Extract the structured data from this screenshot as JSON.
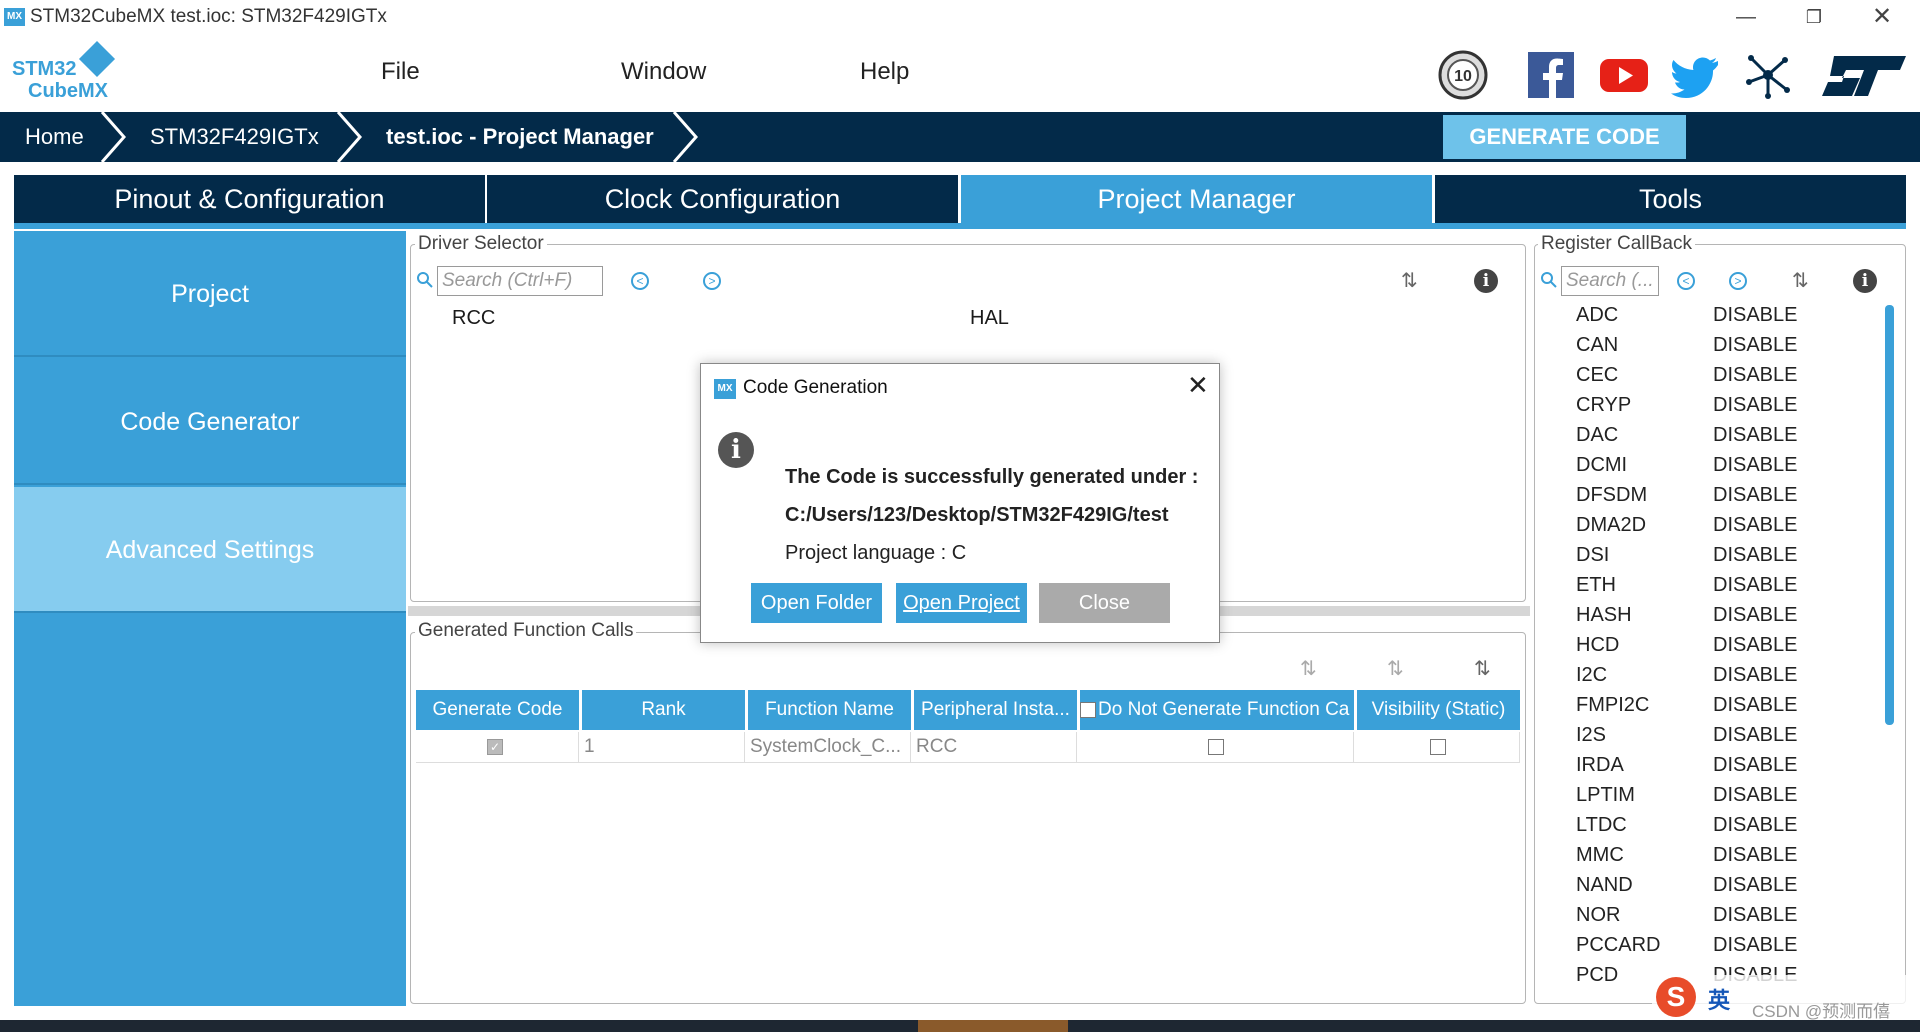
{
  "window": {
    "title": "STM32CubeMX test.ioc: STM32F429IGTx",
    "app_icon": "MX"
  },
  "menu": {
    "logo_line1": "STM32",
    "logo_line2": "CubeMX",
    "items": [
      "File",
      "Window",
      "Help"
    ],
    "social_icons": [
      "anniversary-10-icon",
      "facebook-icon",
      "youtube-icon",
      "twitter-icon",
      "network-icon",
      "st-logo-icon"
    ],
    "anniversary_label": "10"
  },
  "breadcrumb": {
    "items": [
      "Home",
      "STM32F429IGTx",
      "test.ioc - Project Manager"
    ],
    "generate_label": "GENERATE CODE"
  },
  "tabs": [
    {
      "label": "Pinout & Configuration",
      "active": false
    },
    {
      "label": "Clock Configuration",
      "active": false
    },
    {
      "label": "Project Manager",
      "active": true
    },
    {
      "label": "Tools",
      "active": false
    }
  ],
  "left_nav": [
    {
      "label": "Project",
      "selected": false
    },
    {
      "label": "Code Generator",
      "selected": false
    },
    {
      "label": "Advanced Settings",
      "selected": true
    }
  ],
  "driver_selector": {
    "title": "Driver Selector",
    "search_placeholder": "Search (Ctrl+F)",
    "rows": [
      {
        "name": "RCC",
        "driver": "HAL"
      }
    ]
  },
  "generated_calls": {
    "title": "Generated Function Calls",
    "columns": [
      "Generate Code",
      "Rank",
      "Function Name",
      "Peripheral Insta...",
      "Do Not Generate Function Ca",
      "Visibility (Static)"
    ],
    "rows": [
      {
        "generate": true,
        "rank": "1",
        "function": "SystemClock_C...",
        "peripheral": "RCC",
        "no_generate": false,
        "static": false
      }
    ]
  },
  "register_callback": {
    "title": "Register CallBack",
    "search_placeholder": "Search (...",
    "rows": [
      {
        "name": "ADC",
        "value": "DISABLE"
      },
      {
        "name": "CAN",
        "value": "DISABLE"
      },
      {
        "name": "CEC",
        "value": "DISABLE"
      },
      {
        "name": "CRYP",
        "value": "DISABLE"
      },
      {
        "name": "DAC",
        "value": "DISABLE"
      },
      {
        "name": "DCMI",
        "value": "DISABLE"
      },
      {
        "name": "DFSDM",
        "value": "DISABLE"
      },
      {
        "name": "DMA2D",
        "value": "DISABLE"
      },
      {
        "name": "DSI",
        "value": "DISABLE"
      },
      {
        "name": "ETH",
        "value": "DISABLE"
      },
      {
        "name": "HASH",
        "value": "DISABLE"
      },
      {
        "name": "HCD",
        "value": "DISABLE"
      },
      {
        "name": "I2C",
        "value": "DISABLE"
      },
      {
        "name": "FMPI2C",
        "value": "DISABLE"
      },
      {
        "name": "I2S",
        "value": "DISABLE"
      },
      {
        "name": "IRDA",
        "value": "DISABLE"
      },
      {
        "name": "LPTIM",
        "value": "DISABLE"
      },
      {
        "name": "LTDC",
        "value": "DISABLE"
      },
      {
        "name": "MMC",
        "value": "DISABLE"
      },
      {
        "name": "NAND",
        "value": "DISABLE"
      },
      {
        "name": "NOR",
        "value": "DISABLE"
      },
      {
        "name": "PCCARD",
        "value": "DISABLE"
      },
      {
        "name": "PCD",
        "value": "DISABLE"
      }
    ]
  },
  "dialog": {
    "title": "Code Generation",
    "message": "The Code is successfully generated under :",
    "path": "C:/Users/123/Desktop/STM32F429IG/test",
    "language": "Project language : C",
    "buttons": [
      "Open Folder",
      "Open Project",
      "Close"
    ]
  },
  "ime": {
    "logo": "S",
    "mode": "英",
    "watermark": "CSDN @预测而僖"
  },
  "colors": {
    "navy": "#032a49",
    "accent": "#3aa0d8",
    "accent_light": "#86ccef"
  }
}
